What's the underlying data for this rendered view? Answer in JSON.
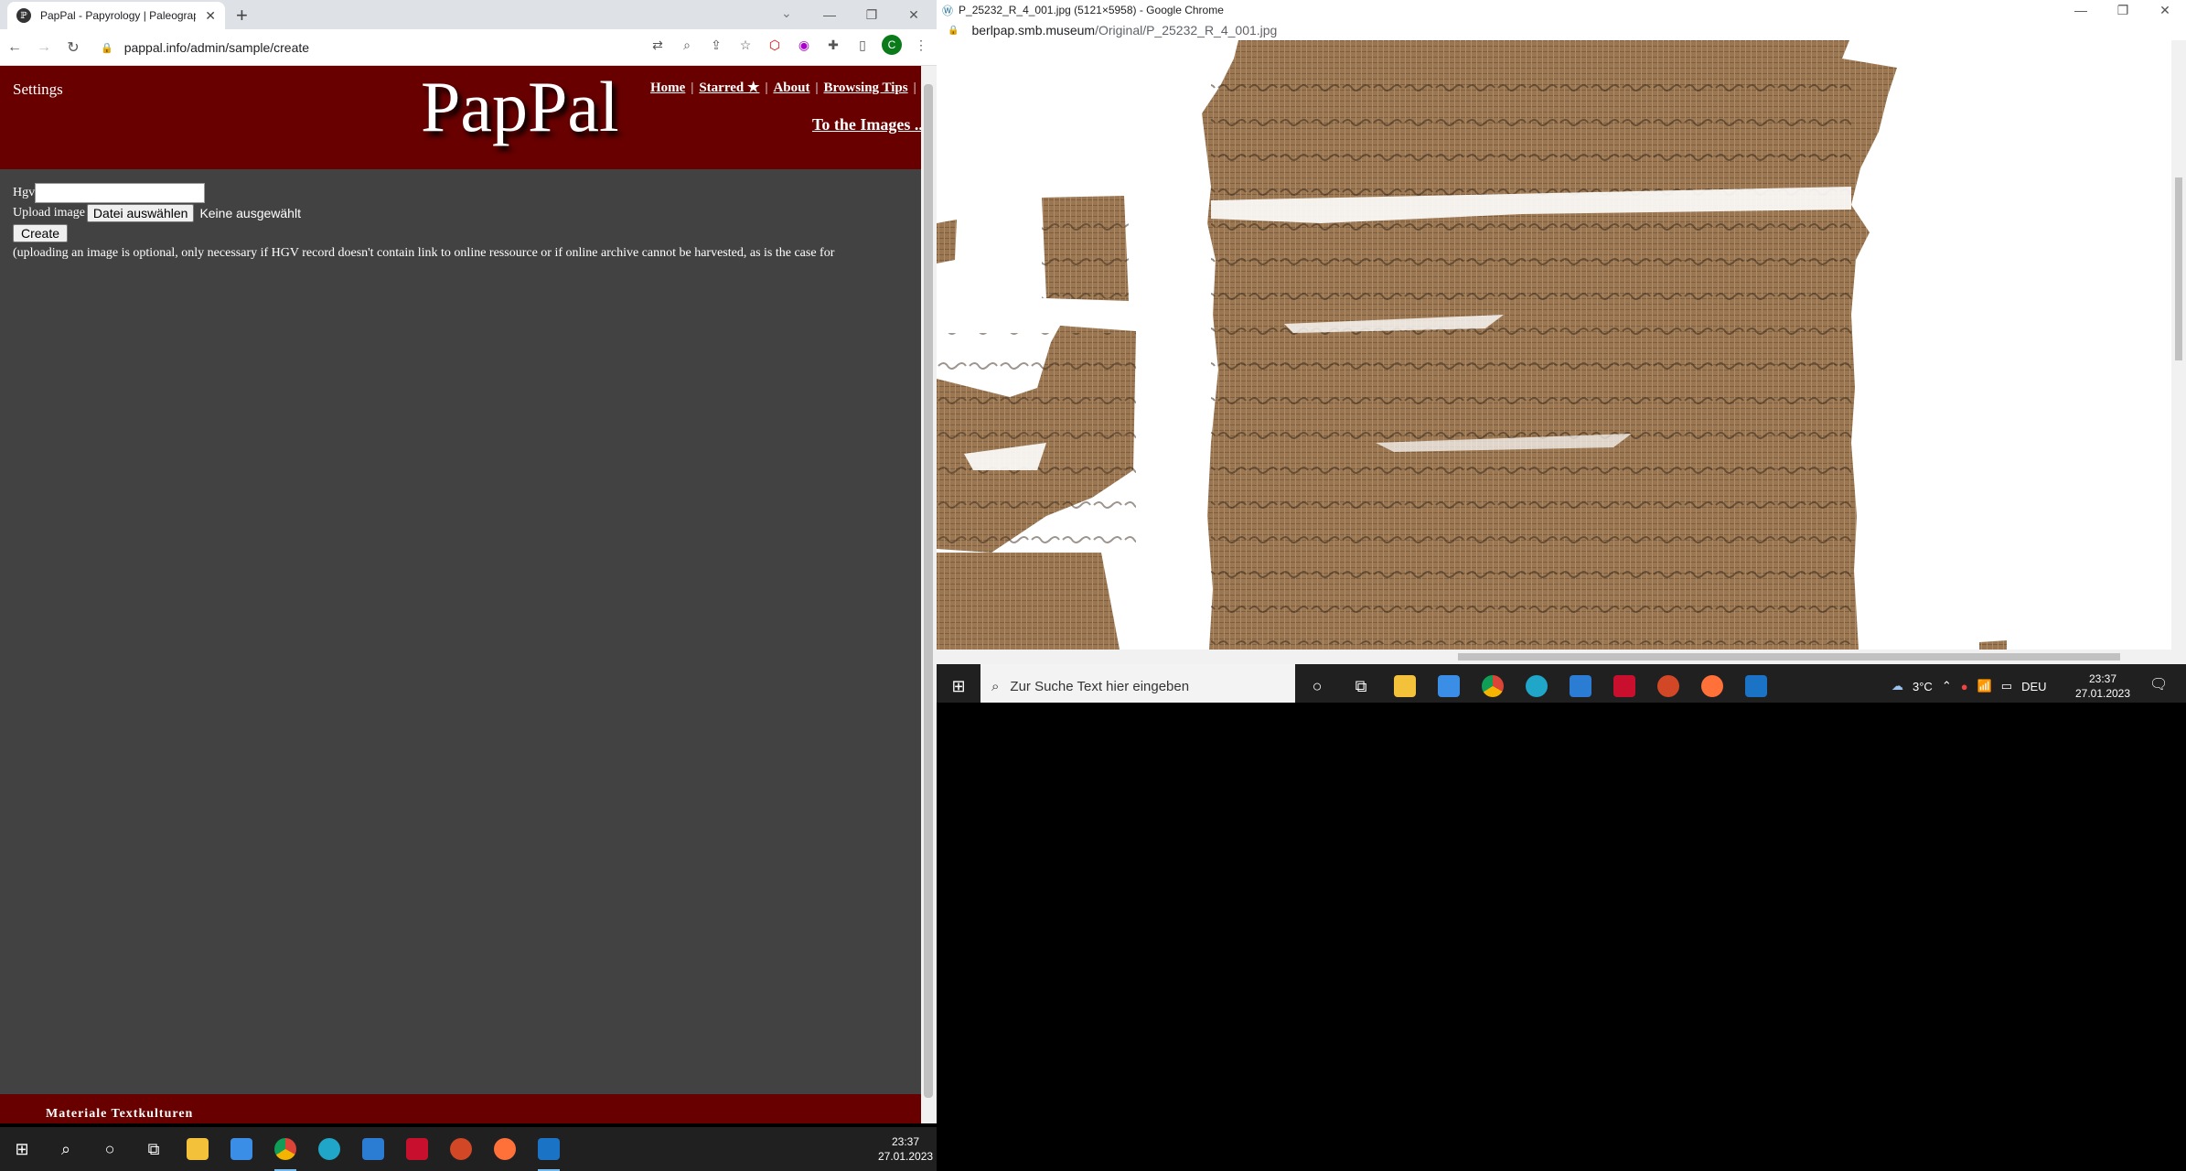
{
  "left_browser": {
    "tab_title": "PapPal - Papyrology | Paleography",
    "url": "pappal.info/admin/sample/create",
    "avatar_letter": "C"
  },
  "page": {
    "settings": "Settings",
    "logo": "PapPal",
    "nav": [
      {
        "label": "Home"
      },
      {
        "label": "Starred ★"
      },
      {
        "label": "About"
      },
      {
        "label": "Browsing Tips"
      }
    ],
    "to_images": "To the Images ...",
    "form": {
      "hgv_label": "Hgv",
      "upload_label": "Upload image",
      "file_button": "Datei auswählen",
      "file_status": "Keine ausgewählt",
      "create_button": "Create",
      "note": "(uploading an image is optional, only necessary if HGV record doesn't contain link to online ressource or if online archive cannot be harvested, as is the case for"
    },
    "footer": "Materiale Textkulturen"
  },
  "right_browser": {
    "title": "P_25232_R_4_001.jpg (5121×5958) - Google Chrome",
    "url_host": "berlpap.smb.museum",
    "url_path": "/Original/P_25232_R_4_001.jpg"
  },
  "taskbar_left": {
    "time": "23:37",
    "date": "27.01.2023"
  },
  "taskbar_right": {
    "search_placeholder": "Zur Suche Text hier eingeben",
    "weather": "3°C",
    "lang": "DEU",
    "time": "23:37",
    "date": "27.01.2023"
  },
  "colors": {
    "header_red": "#680000",
    "page_bg": "#424242"
  }
}
